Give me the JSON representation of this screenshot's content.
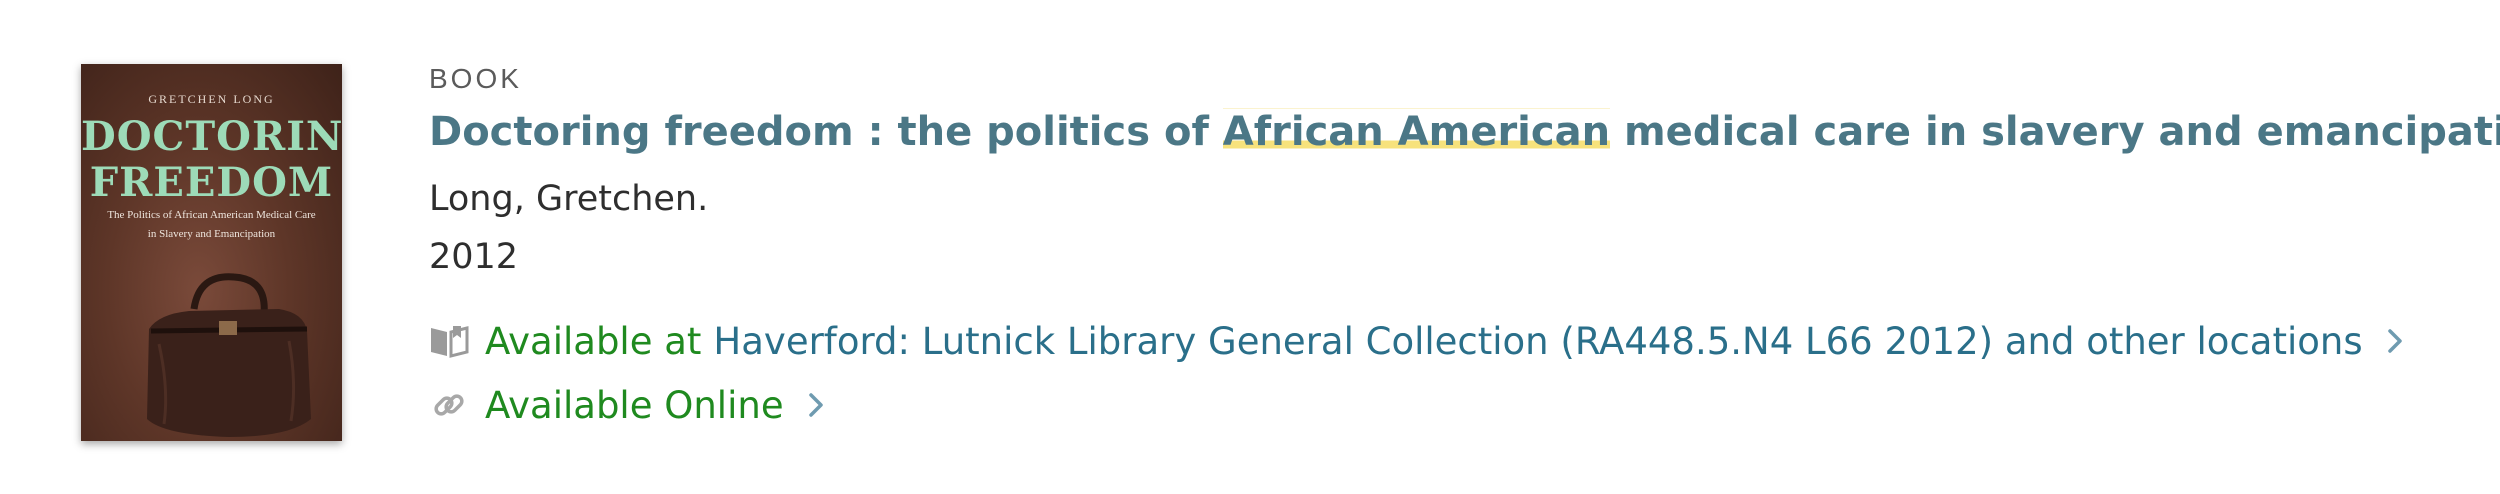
{
  "record": {
    "format": "BOOK",
    "title_parts": {
      "before": "Doctoring freedom : the politics of ",
      "highlight": "African American",
      "after": " medical care in slavery and emancipation"
    },
    "author": "Long, Gretchen.",
    "year": "2012",
    "cover": {
      "author": "GRETCHEN LONG",
      "title_line1": "DOCTORING",
      "title_line2": "FREEDOM",
      "subtitle_line1": "The Politics of African American Medical Care",
      "subtitle_line2": "in Slavery and Emancipation"
    },
    "availability": [
      {
        "status": "Available at",
        "location": "Haverford: Lutnick Library  General Collection (RA448.5.N4 L66 2012) and other locations",
        "icon": "book-icon"
      },
      {
        "status": "Available Online",
        "location": "",
        "icon": "link-icon"
      }
    ]
  },
  "colors": {
    "title": "#4b7786",
    "available": "#1f8a1f",
    "location": "#2a6f8a",
    "highlight": "#f7e27c"
  }
}
